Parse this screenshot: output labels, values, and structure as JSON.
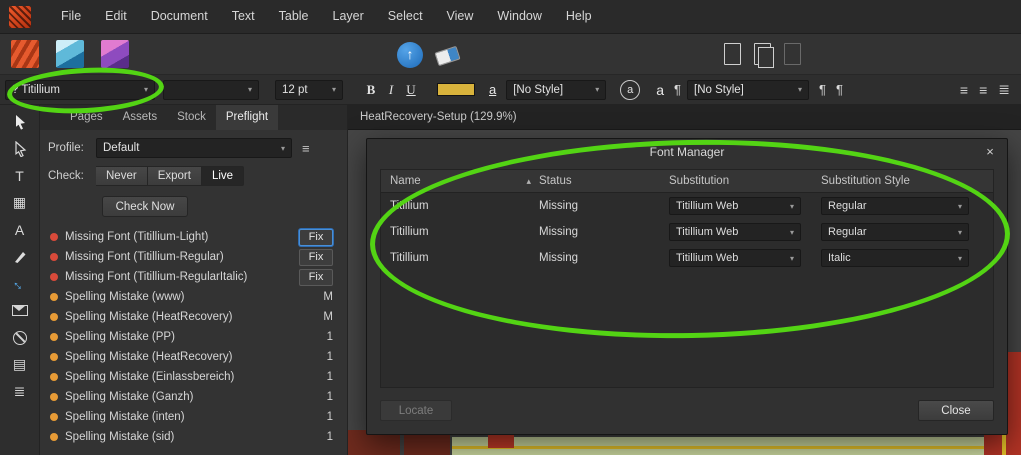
{
  "colors": {
    "annotation": "#53d414",
    "fill_swatch": "#d9b33c",
    "error_dot": "#d84a3a",
    "warning_dot": "#e79b36"
  },
  "icons": {
    "combo_arrow": "▾",
    "sort_asc": "▴",
    "hamburger": "≡",
    "pilcrow": "¶",
    "close": "×",
    "up_arrow": "↑",
    "list_a": "≡",
    "list_b": "≡",
    "list_c": "≣",
    "tool_frame_text": "T",
    "tool_table": "▦",
    "tool_artistic_text": "A",
    "tool_transform": "↔",
    "tool_picture": "▤",
    "tool_layers": "≣"
  },
  "menubar": {
    "items": [
      "File",
      "Edit",
      "Document",
      "Text",
      "Table",
      "Layer",
      "Select",
      "View",
      "Window",
      "Help"
    ]
  },
  "formatting": {
    "font_name": "? Titillium",
    "font_traits": "",
    "font_size": "12 pt",
    "bold": "B",
    "italic": "I",
    "underline": "U",
    "char_letter": "a",
    "char_style": "[No Style]",
    "para_style": "[No Style]"
  },
  "preflight": {
    "tabs": [
      {
        "label": "Pages"
      },
      {
        "label": "Assets"
      },
      {
        "label": "Stock"
      },
      {
        "label": "Preflight",
        "state": "active"
      }
    ],
    "profile_label": "Profile:",
    "profile_value": "Default",
    "check_label": "Check:",
    "check_options": [
      {
        "label": "Never"
      },
      {
        "label": "Export"
      },
      {
        "label": "Live",
        "state": "active"
      }
    ],
    "check_now_label": "Check Now",
    "issues": [
      {
        "type": "error",
        "label": "Missing Font (Titillium-Light)",
        "action": "Fix",
        "focus": "focused"
      },
      {
        "type": "error",
        "label": "Missing Font (Titillium-Regular)",
        "action": "Fix"
      },
      {
        "type": "error",
        "label": "Missing Font (Titillium-RegularItalic)",
        "action": "Fix"
      },
      {
        "type": "warning",
        "label": "Spelling Mistake (www)",
        "count": "M"
      },
      {
        "type": "warning",
        "label": "Spelling Mistake (HeatRecovery)",
        "count": "M"
      },
      {
        "type": "warning",
        "label": "Spelling Mistake (PP)",
        "count": "1"
      },
      {
        "type": "warning",
        "label": "Spelling Mistake (HeatRecovery)",
        "count": "1"
      },
      {
        "type": "warning",
        "label": "Spelling Mistake (Einlassbereich)",
        "count": "1"
      },
      {
        "type": "warning",
        "label": "Spelling Mistake (Ganzh)",
        "count": "1"
      },
      {
        "type": "warning",
        "label": "Spelling Mistake (inten)",
        "count": "1"
      },
      {
        "type": "warning",
        "label": "Spelling Mistake (sid)",
        "count": "1"
      }
    ]
  },
  "document": {
    "tab_title": "HeatRecovery-Setup (129.9%)"
  },
  "font_manager": {
    "title": "Font Manager",
    "columns": {
      "name": "Name",
      "status": "Status",
      "substitution": "Substitution",
      "style": "Substitution Style"
    },
    "rows": [
      {
        "name": "Titillium",
        "status": "Missing",
        "substitution": "Titillium Web",
        "style": "Regular"
      },
      {
        "name": "Titillium",
        "status": "Missing",
        "substitution": "Titillium Web",
        "style": "Regular"
      },
      {
        "name": "Titillium",
        "status": "Missing",
        "substitution": "Titillium Web",
        "style": "Italic"
      }
    ],
    "locate_label": "Locate",
    "close_label": "Close"
  }
}
